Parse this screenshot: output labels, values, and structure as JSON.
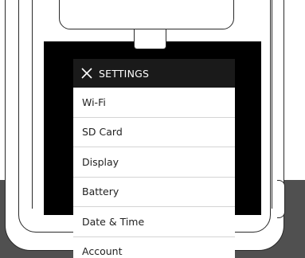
{
  "settings": {
    "title": "SETTINGS",
    "close_icon": "close-icon",
    "items": [
      {
        "label": "Wi-Fi"
      },
      {
        "label": "SD Card"
      },
      {
        "label": "Display"
      },
      {
        "label": "Battery"
      },
      {
        "label": "Date & Time"
      },
      {
        "label": "Account"
      }
    ]
  },
  "colors": {
    "header_bg": "#1a1a1a",
    "screen_bg": "#000000",
    "desk_bg": "#505050",
    "item_text": "#222222",
    "divider": "#d4d4d4"
  }
}
